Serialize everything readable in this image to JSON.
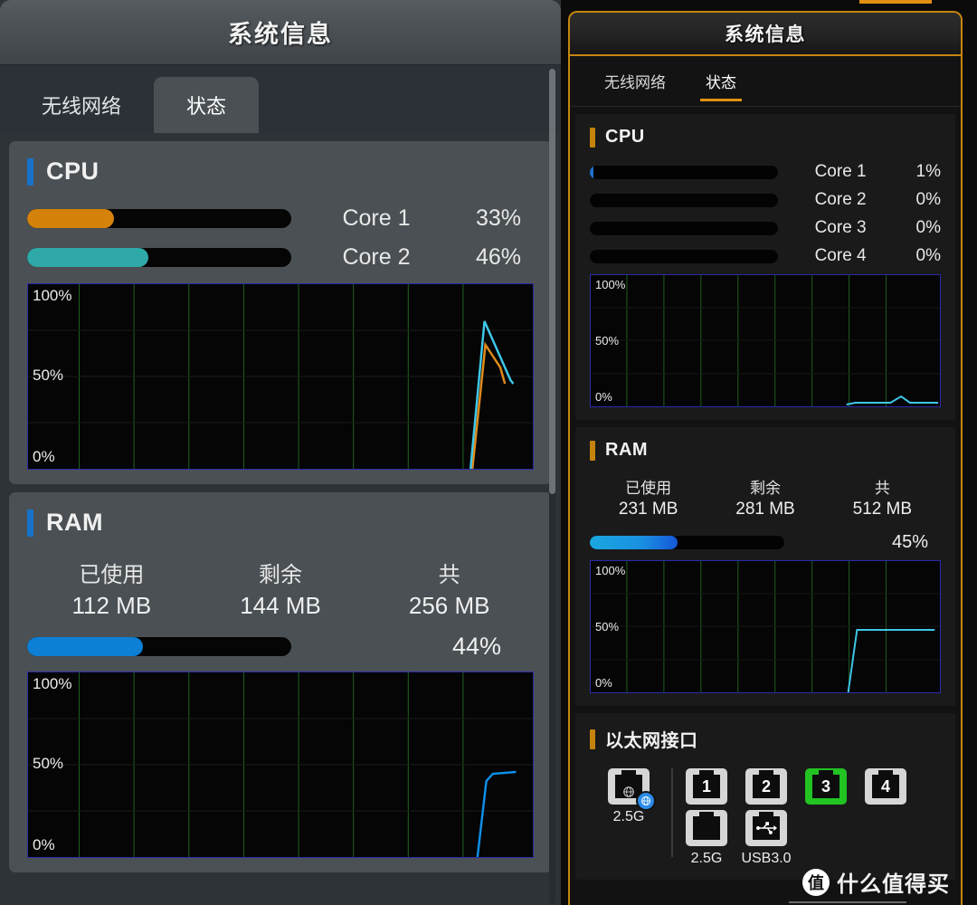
{
  "left_panel": {
    "title": "系统信息",
    "tabs": [
      {
        "label": "无线网络",
        "active": false
      },
      {
        "label": "状态",
        "active": true
      }
    ],
    "cpu": {
      "title": "CPU",
      "cores": [
        {
          "label": "Core 1",
          "percent_text": "33%",
          "percent": 33,
          "color": "#d4820a"
        },
        {
          "label": "Core 2",
          "percent_text": "46%",
          "percent": 46,
          "color": "#2fa8a8"
        }
      ],
      "graph": {
        "top": "100%",
        "mid": "50%",
        "bottom": "0%"
      }
    },
    "ram": {
      "title": "RAM",
      "used_key": "已使用",
      "used_val": "112 MB",
      "free_key": "剩余",
      "free_val": "144 MB",
      "total_key": "共",
      "total_val": "256 MB",
      "percent_text": "44%",
      "percent": 44,
      "color": "#0d7fd4",
      "graph": {
        "top": "100%",
        "mid": "50%",
        "bottom": "0%"
      }
    }
  },
  "right_panel": {
    "title": "系统信息",
    "tabs": [
      {
        "label": "无线网络",
        "active": false
      },
      {
        "label": "状态",
        "active": true
      }
    ],
    "cpu": {
      "title": "CPU",
      "cores": [
        {
          "label": "Core 1",
          "percent_text": "1%",
          "percent": 1,
          "color": "#1f6fd0"
        },
        {
          "label": "Core 2",
          "percent_text": "0%",
          "percent": 0,
          "color": "#1f6fd0"
        },
        {
          "label": "Core 3",
          "percent_text": "0%",
          "percent": 0,
          "color": "#1f6fd0"
        },
        {
          "label": "Core 4",
          "percent_text": "0%",
          "percent": 0,
          "color": "#1f6fd0"
        }
      ],
      "graph": {
        "top": "100%",
        "mid": "50%",
        "bottom": "0%"
      }
    },
    "ram": {
      "title": "RAM",
      "used_key": "已使用",
      "used_val": "231 MB",
      "free_key": "剩余",
      "free_val": "281 MB",
      "total_key": "共",
      "total_val": "512 MB",
      "percent_text": "45%",
      "percent": 45,
      "color": "#1a8fe0",
      "graph": {
        "top": "100%",
        "mid": "50%",
        "bottom": "0%"
      }
    },
    "ethernet": {
      "title": "以太网接口",
      "wan": {
        "icon": "globe-icon",
        "caption": "2.5G"
      },
      "ports_row1": [
        {
          "num": "1",
          "active": false
        },
        {
          "num": "2",
          "active": false
        },
        {
          "num": "3",
          "active": true
        },
        {
          "num": "4",
          "active": false
        }
      ],
      "ports_row2": [
        {
          "num": "",
          "caption": "2.5G",
          "icon": "lan-port-icon",
          "active": false
        },
        {
          "num": "",
          "caption": "USB3.0",
          "icon": "usb-icon",
          "active": false
        }
      ]
    }
  },
  "watermark": {
    "logo_char": "值",
    "text": "什么值得买"
  },
  "chart_data": [
    {
      "type": "line",
      "title": "Left CPU usage history",
      "ylabel": "%",
      "ylim": [
        0,
        100
      ],
      "grid": true,
      "yticks": [
        "0%",
        "50%",
        "100%"
      ],
      "series": [
        {
          "name": "Core 1",
          "color": "#e08a1a",
          "points": [
            [
              0,
              0
            ],
            [
              0.875,
              0
            ],
            [
              0.905,
              66
            ],
            [
              0.955,
              45
            ],
            [
              0.975,
              37
            ]
          ]
        },
        {
          "name": "Core 2",
          "color": "#3fc7e8",
          "points": [
            [
              0,
              0
            ],
            [
              0.872,
              0
            ],
            [
              0.902,
              92
            ],
            [
              0.96,
              55
            ],
            [
              0.975,
              48
            ]
          ]
        }
      ]
    },
    {
      "type": "line",
      "title": "Left RAM usage history",
      "ylabel": "%",
      "ylim": [
        0,
        100
      ],
      "grid": true,
      "yticks": [
        "0%",
        "50%",
        "100%"
      ],
      "series": [
        {
          "name": "RAM",
          "color": "#0f8fe8",
          "points": [
            [
              0,
              0
            ],
            [
              0.885,
              0
            ],
            [
              0.915,
              44
            ],
            [
              0.985,
              45
            ]
          ]
        }
      ]
    },
    {
      "type": "line",
      "title": "Right CPU usage history",
      "ylabel": "%",
      "ylim": [
        0,
        100
      ],
      "grid": true,
      "yticks": [
        "0%",
        "50%",
        "100%"
      ],
      "series": [
        {
          "name": "CPU",
          "color": "#3fc7e8",
          "points": [
            [
              0,
              0
            ],
            [
              0.76,
              0
            ],
            [
              0.8,
              1
            ],
            [
              0.875,
              1
            ],
            [
              0.9,
              5
            ],
            [
              0.93,
              1
            ],
            [
              0.99,
              1
            ]
          ]
        }
      ]
    },
    {
      "type": "line",
      "title": "Right RAM usage history",
      "ylabel": "%",
      "ylim": [
        0,
        100
      ],
      "grid": true,
      "yticks": [
        "0%",
        "50%",
        "100%"
      ],
      "series": [
        {
          "name": "RAM",
          "color": "#3fc7e8",
          "points": [
            [
              0,
              0
            ],
            [
              0.775,
              0
            ],
            [
              0.8,
              45
            ],
            [
              0.985,
              45
            ]
          ]
        }
      ]
    }
  ]
}
